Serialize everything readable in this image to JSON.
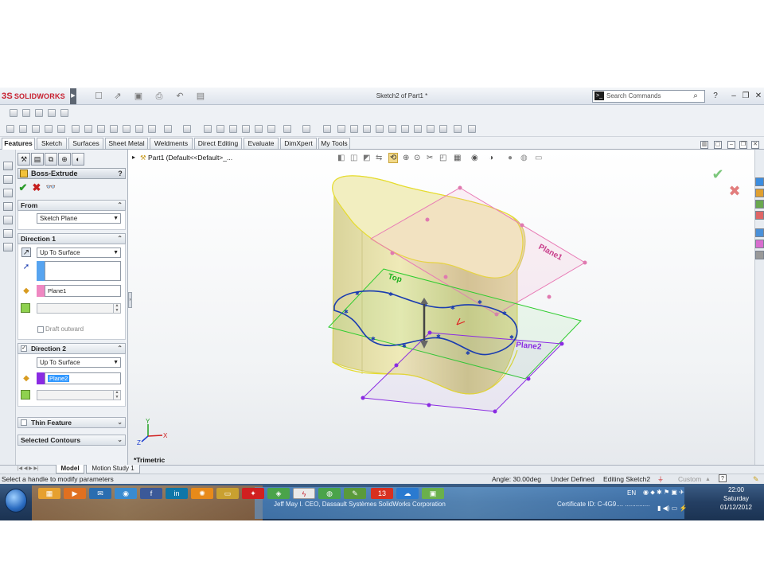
{
  "app": {
    "brand": "SOLIDWORKS",
    "brand_prefix": "3S",
    "window_title": "Sketch2 of Part1 *",
    "search_placeholder": "Search Commands",
    "help_label": "?"
  },
  "tabs": [
    "Features",
    "Sketch",
    "Surfaces",
    "Sheet Metal",
    "Weldments",
    "Direct Editing",
    "Evaluate",
    "DimXpert",
    "My Tools"
  ],
  "active_tab": "Features",
  "property_manager": {
    "title": "Boss-Extrude",
    "help": "?",
    "from": {
      "label": "From",
      "value": "Sketch Plane"
    },
    "direction1": {
      "label": "Direction 1",
      "end_condition": "Up To Surface",
      "surface": "Plane1",
      "draft_label": "Draft outward"
    },
    "direction2": {
      "label": "Direction 2",
      "end_condition": "Up To Surface",
      "surface": "Plane2"
    },
    "thin_feature": "Thin Feature",
    "selected_contours": "Selected Contours"
  },
  "viewport": {
    "tree_root": "Part1  (Default<<Default>_...",
    "view_name": "*Trimetric",
    "plane_labels": {
      "plane1": "Plane1",
      "plane2": "Plane2",
      "top": "Top"
    }
  },
  "bottom_tabs": [
    "Model",
    "Motion Study 1"
  ],
  "active_bottom_tab": "Model",
  "status": {
    "message": "Select a handle to modify parameters",
    "angle": "Angle: 30.00deg",
    "definition": "Under Defined",
    "editing": "Editing Sketch2",
    "units": "Custom"
  },
  "taskbar": {
    "banner": "Jeff May I. CEO, Dassault Systèmes SolidWorks Corporation",
    "certificate": "Certificate ID: C-4G9.... ..............",
    "language": "EN",
    "time": "22:00",
    "day": "Saturday",
    "date": "01/12/2012"
  },
  "colors": {
    "accent_red": "#c8202f",
    "plane1": "#e87bb5",
    "plane2": "#8a2be2",
    "top_plane": "#2ecc2e",
    "sketch": "#1a3cb0",
    "body": "#e9e3a6"
  }
}
